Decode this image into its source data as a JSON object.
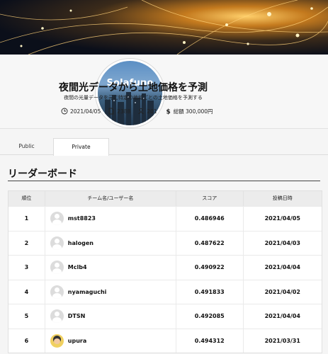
{
  "banner": {
    "logo_text": "Solafune"
  },
  "competition": {
    "title": "夜間光データから土地価格を予測",
    "subtitle": "夜間の光量データを元に特定の地域ごとの土地価格を予測する",
    "date": "2021/04/05",
    "submissions": "2388",
    "participants": "201",
    "prize": "総額 300,000円"
  },
  "tabs": [
    {
      "label": "Public"
    },
    {
      "label": "Private"
    }
  ],
  "leaderboard": {
    "title": "リーダーボード",
    "headers": {
      "rank": "順位",
      "team": "チーム名/ユーザー名",
      "score": "スコア",
      "date": "投稿日時"
    },
    "rows": [
      {
        "rank": "1",
        "user": "mst8823",
        "score": "0.486946",
        "date": "2021/04/05",
        "avatar": "default"
      },
      {
        "rank": "2",
        "user": "halogen",
        "score": "0.487622",
        "date": "2021/04/03",
        "avatar": "default"
      },
      {
        "rank": "3",
        "user": "Mclb4",
        "score": "0.490922",
        "date": "2021/04/04",
        "avatar": "default"
      },
      {
        "rank": "4",
        "user": "nyamaguchi",
        "score": "0.491833",
        "date": "2021/04/02",
        "avatar": "default"
      },
      {
        "rank": "5",
        "user": "DTSN",
        "score": "0.492085",
        "date": "2021/04/04",
        "avatar": "default"
      },
      {
        "rank": "6",
        "user": "upura",
        "score": "0.494312",
        "date": "2021/03/31",
        "avatar": "photo"
      }
    ]
  }
}
